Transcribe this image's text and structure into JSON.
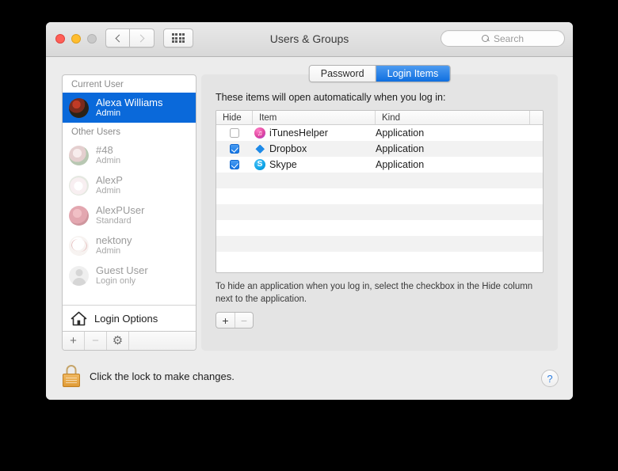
{
  "window": {
    "title": "Users & Groups",
    "traffic_lights": [
      "close",
      "minimize",
      "zoom"
    ],
    "nav": {
      "back": "‹",
      "forward": "›",
      "show_all": "grid"
    },
    "search": {
      "placeholder": "Search"
    }
  },
  "sidebar": {
    "sections": [
      {
        "header": "Current User",
        "users": [
          {
            "name": "Alexa Williams",
            "role": "Admin",
            "selected": true,
            "avatar": "av-alexa"
          }
        ]
      },
      {
        "header": "Other Users",
        "users": [
          {
            "name": "#48",
            "role": "Admin",
            "selected": false,
            "avatar": "av-48"
          },
          {
            "name": "AlexP",
            "role": "Admin",
            "selected": false,
            "avatar": "av-alexp"
          },
          {
            "name": "AlexPUser",
            "role": "Standard",
            "selected": false,
            "avatar": "av-alexpu"
          },
          {
            "name": "nektony",
            "role": "Admin",
            "selected": false,
            "avatar": "av-nek"
          },
          {
            "name": "Guest User",
            "role": "Login only",
            "selected": false,
            "avatar": "av-guest"
          }
        ]
      }
    ],
    "login_options": "Login Options",
    "toolbar": {
      "add": "+",
      "remove": "−",
      "settings": "⚙"
    }
  },
  "panel": {
    "tabs": [
      {
        "label": "Password",
        "active": false
      },
      {
        "label": "Login Items",
        "active": true
      }
    ],
    "caption": "These items will open automatically when you log in:",
    "table": {
      "columns": [
        "Hide",
        "Item",
        "Kind"
      ],
      "rows": [
        {
          "hide": false,
          "item": "iTunesHelper",
          "kind": "Application",
          "icon": "itunes-icon"
        },
        {
          "hide": true,
          "item": "Dropbox",
          "kind": "Application",
          "icon": "dropbox-icon"
        },
        {
          "hide": true,
          "item": "Skype",
          "kind": "Application",
          "icon": "skype-icon"
        }
      ]
    },
    "note": "To hide an application when you log in, select the checkbox in the Hide column next to the application.",
    "add_remove": {
      "add": "+",
      "remove": "−"
    }
  },
  "footer": {
    "lock_text": "Click the lock to make changes.",
    "lock_state": "locked",
    "help": "?"
  },
  "colors": {
    "accent": "#0a69da",
    "tab_active": "#0f6fe0",
    "window_bg": "#ececec",
    "panel_bg": "#e4e4e4",
    "lock_gold": "#e09b36",
    "help_blue": "#2f7fe0"
  }
}
